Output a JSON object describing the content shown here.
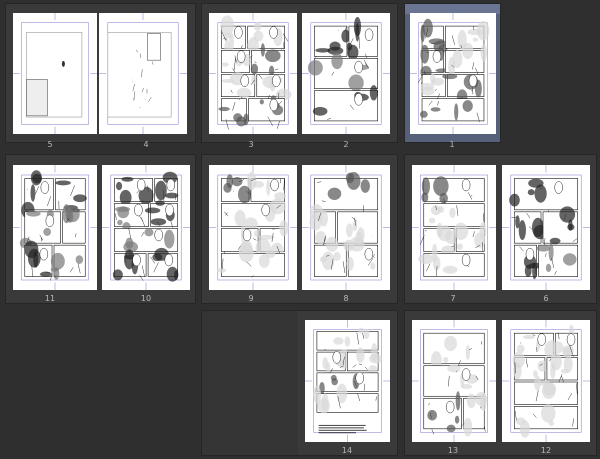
{
  "app": {
    "view": "page-manager",
    "colors": {
      "background": "#2f2f2f",
      "spread": "#3a3a3a",
      "selected_spread": "#56607a",
      "guide_line": "#7b78c8",
      "page_number": "#b8b8b8"
    }
  },
  "pages": {
    "p1": {
      "number": "1"
    },
    "p2": {
      "number": "2"
    },
    "p3": {
      "number": "3"
    },
    "p4": {
      "number": "4"
    },
    "p5": {
      "number": "5"
    },
    "p6": {
      "number": "6"
    },
    "p7": {
      "number": "7"
    },
    "p8": {
      "number": "8"
    },
    "p9": {
      "number": "9"
    },
    "p10": {
      "number": "10"
    },
    "p11": {
      "number": "11"
    },
    "p12": {
      "number": "12"
    },
    "p13": {
      "number": "13"
    },
    "p14": {
      "number": "14"
    }
  },
  "selected_page": "1"
}
